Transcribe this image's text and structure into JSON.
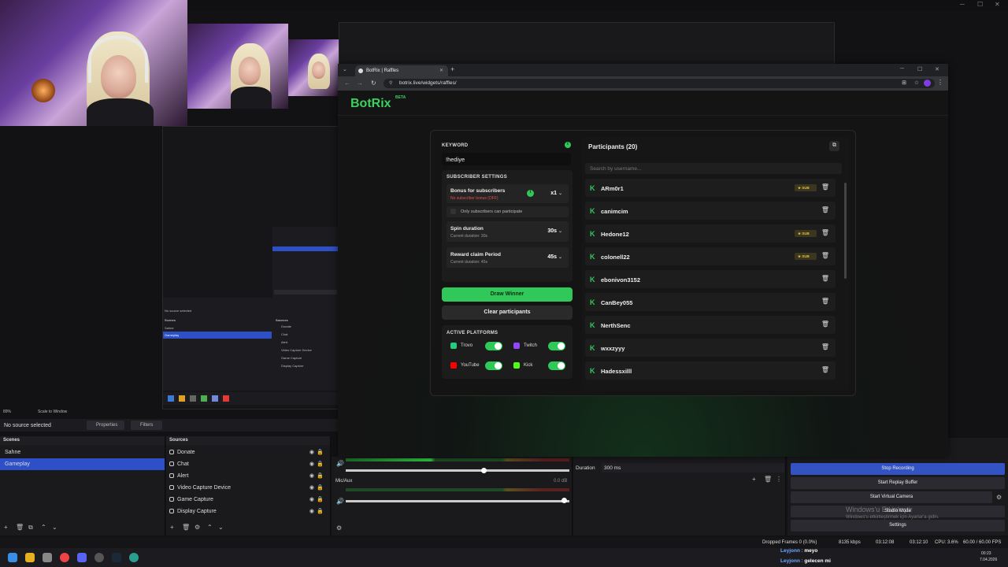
{
  "obs": {
    "zoom": "89%",
    "scale_to_window": "Scale to Window",
    "no_source": "No source selected",
    "properties_label": "Properties",
    "filters_label": "Filters",
    "scenes_header": "Scenes",
    "sources_header": "Sources",
    "scenes": [
      "Sahne",
      "Gameplay"
    ],
    "sources": [
      "Donate",
      "Chat",
      "Alert",
      "Video Capture Device",
      "Game Capture",
      "Display Capture"
    ],
    "audio_track2": "Mic/Aux",
    "audio_db": "0.0 dB",
    "duration_label": "Duration",
    "duration_value": "300 ms",
    "controls": {
      "stop_recording": "Stop Recording",
      "replay_buffer": "Start Replay Buffer",
      "virtual_camera": "Start Virtual Camera",
      "studio_mode": "Studio Mode",
      "settings": "Settings"
    },
    "activate_windows": "Windows'u Etkinleştir",
    "activate_windows_sub": "Windows'u etkinleştirmek için Ayarlar'a gidin.",
    "status": {
      "dropped": "Dropped Frames 0 (0.0%)",
      "kbps": "8135 kbps",
      "stream_time": "03:12:08",
      "rec_time": "03:12:10",
      "cpu": "CPU: 3.6%",
      "fps": "60.00 / 60.00 FPS"
    },
    "chat": [
      {
        "user": "Leyjonn",
        "msg": "meyo"
      },
      {
        "user": "Leyjonn",
        "msg": "gelecen mi"
      }
    ]
  },
  "browser": {
    "tab_title": "BotRix | Raffles",
    "url": "botrix.live/widgets/raffles/"
  },
  "botrix": {
    "logo": "BotRix",
    "beta": "BETA",
    "keyword_label": "KEYWORD",
    "keyword_value": "!hediye",
    "subscriber_settings_label": "SUBSCRIBER SETTINGS",
    "bonus_label": "Bonus for subscribers",
    "bonus_sub": "No subscriber bonus (OFF)",
    "bonus_value": "x1",
    "only_subs": "Only subscribers can participate",
    "spin_label": "Spin duration",
    "spin_sub": "Current duration: 30s",
    "spin_value": "30s",
    "claim_label": "Reward claim Period",
    "claim_sub": "Current duration: 45s",
    "claim_value": "45s",
    "draw_button": "Draw Winner",
    "clear_button": "Clear participants",
    "platforms_label": "ACTIVE PLATFORMS",
    "platforms": [
      {
        "name": "Trovo",
        "color": "#1fcf7b"
      },
      {
        "name": "Twitch",
        "color": "#9146ff"
      },
      {
        "name": "YouTube",
        "color": "#ff0000"
      },
      {
        "name": "Kick",
        "color": "#53fc18"
      }
    ],
    "participants_title": "Participants (20)",
    "search_placeholder": "Search by username...",
    "sub_badge": "SUB",
    "participants": [
      {
        "name": "ARm0r1",
        "sub": true
      },
      {
        "name": "canimcim",
        "sub": false
      },
      {
        "name": "Hedone12",
        "sub": true
      },
      {
        "name": "colonell22",
        "sub": true
      },
      {
        "name": "ebonivon3152",
        "sub": false
      },
      {
        "name": "CanBey055",
        "sub": false
      },
      {
        "name": "NerthSenc",
        "sub": false
      },
      {
        "name": "wxxzyyy",
        "sub": false
      },
      {
        "name": "Hadessxilll",
        "sub": false
      }
    ]
  },
  "taskbar": {
    "time": "00:23",
    "date": "7.04.2026"
  },
  "colors": {
    "accent_green": "#31c85a",
    "obs_selected": "#2d4fc8"
  }
}
